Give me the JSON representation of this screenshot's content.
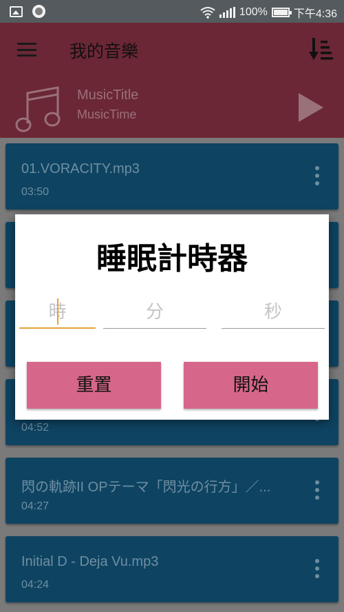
{
  "status_bar": {
    "battery": "100%",
    "time": "下午4:36"
  },
  "toolbar": {
    "title": "我的音樂"
  },
  "now_playing": {
    "title": "MusicTitle",
    "time": "MusicTime"
  },
  "songs": [
    {
      "title": "01.VORACITY.mp3",
      "time": "03:50"
    },
    {
      "title": "",
      "time": ""
    },
    {
      "title": "",
      "time": ""
    },
    {
      "title": "",
      "time": "04:52"
    },
    {
      "title": "閃の軌跡II OPテーマ「閃光の行方」／...",
      "time": "04:27"
    },
    {
      "title": "Initial D - Deja Vu.mp3",
      "time": "04:24"
    }
  ],
  "dialog": {
    "title": "睡眠計時器",
    "hour_placeholder": "時",
    "minute_placeholder": "分",
    "second_placeholder": "秒",
    "reset_label": "重置",
    "start_label": "開始"
  },
  "colors": {
    "toolbar": "#6b2735",
    "card": "#0e4462",
    "button": "#d6678a",
    "input_focus": "#e5a13a"
  }
}
